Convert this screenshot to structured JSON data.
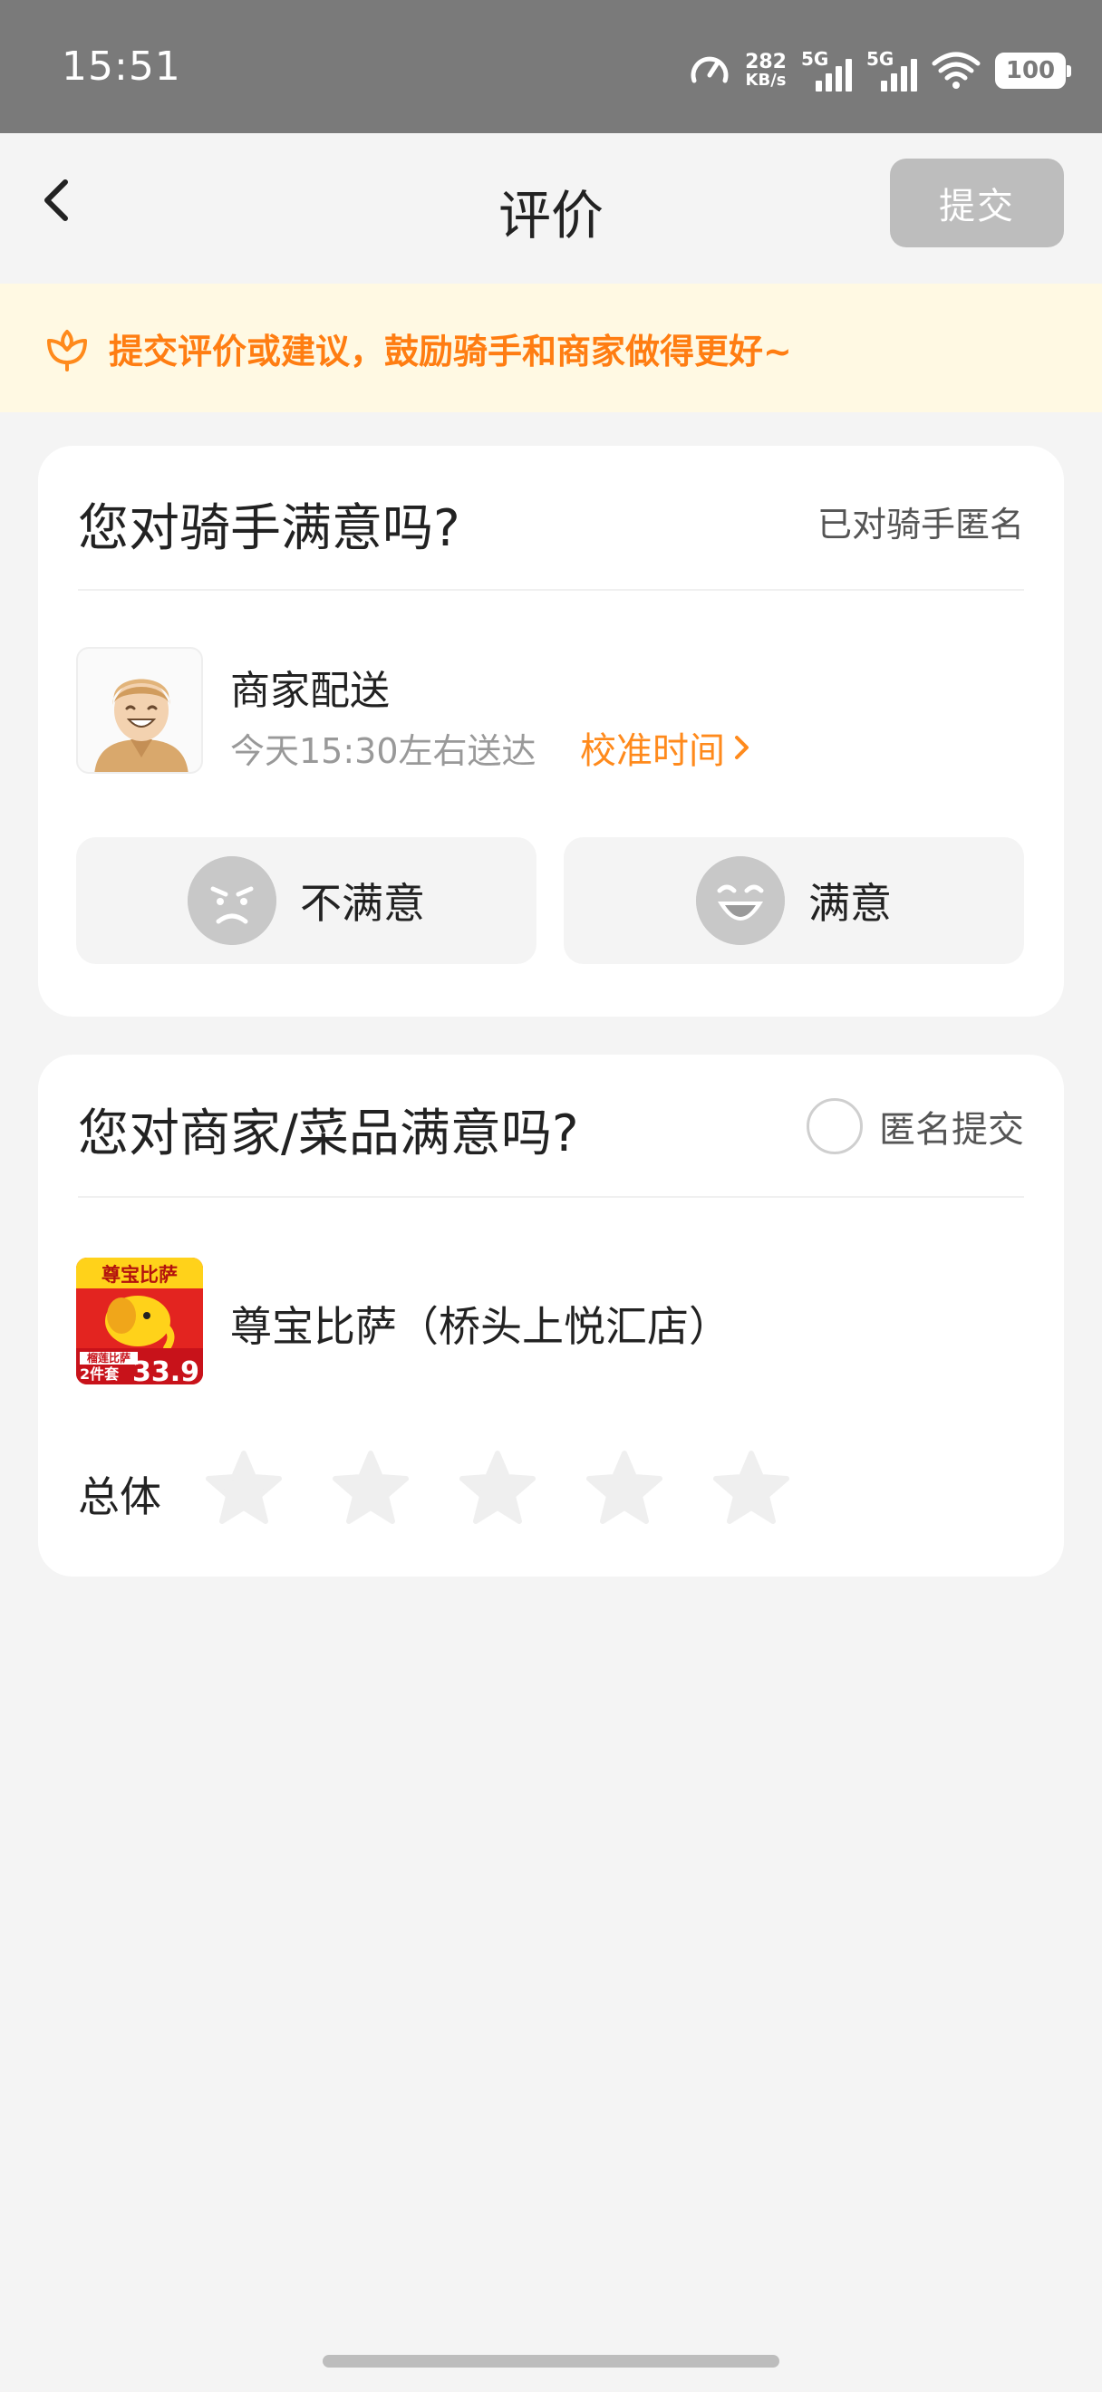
{
  "status_bar": {
    "time": "15:51",
    "speed_value": "282",
    "speed_unit": "KB/s",
    "network_1": "5G",
    "network_2": "5G",
    "battery": "100"
  },
  "nav": {
    "title": "评价",
    "submit_label": "提交"
  },
  "tip": {
    "text": "提交评价或建议，鼓励骑手和商家做得更好~"
  },
  "rider_card": {
    "title": "您对骑手满意吗?",
    "anonymous_note": "已对骑手匿名",
    "delivery_name": "商家配送",
    "delivery_time": "今天15:30左右送达",
    "calibrate_label": "校准时间",
    "unsatisfied_label": "不满意",
    "satisfied_label": "满意"
  },
  "merchant_card": {
    "title": "您对商家/菜品满意吗?",
    "anonymous_label": "匿名提交",
    "shop_name": "尊宝比萨（桥头上悦汇店）",
    "logo_text_top": "尊宝比萨",
    "logo_text_promo": "榴莲比萨",
    "logo_text_set": "2件套",
    "logo_price": "33.9",
    "overall_label": "总体",
    "rating": 0,
    "max_rating": 5
  },
  "colors": {
    "accent": "#ff8a1c",
    "tip_bg": "#fff9e3",
    "tip_text": "#ff7d12",
    "submit_disabled": "#bdbdbd",
    "status_bar_bg": "#7a7a7a"
  }
}
